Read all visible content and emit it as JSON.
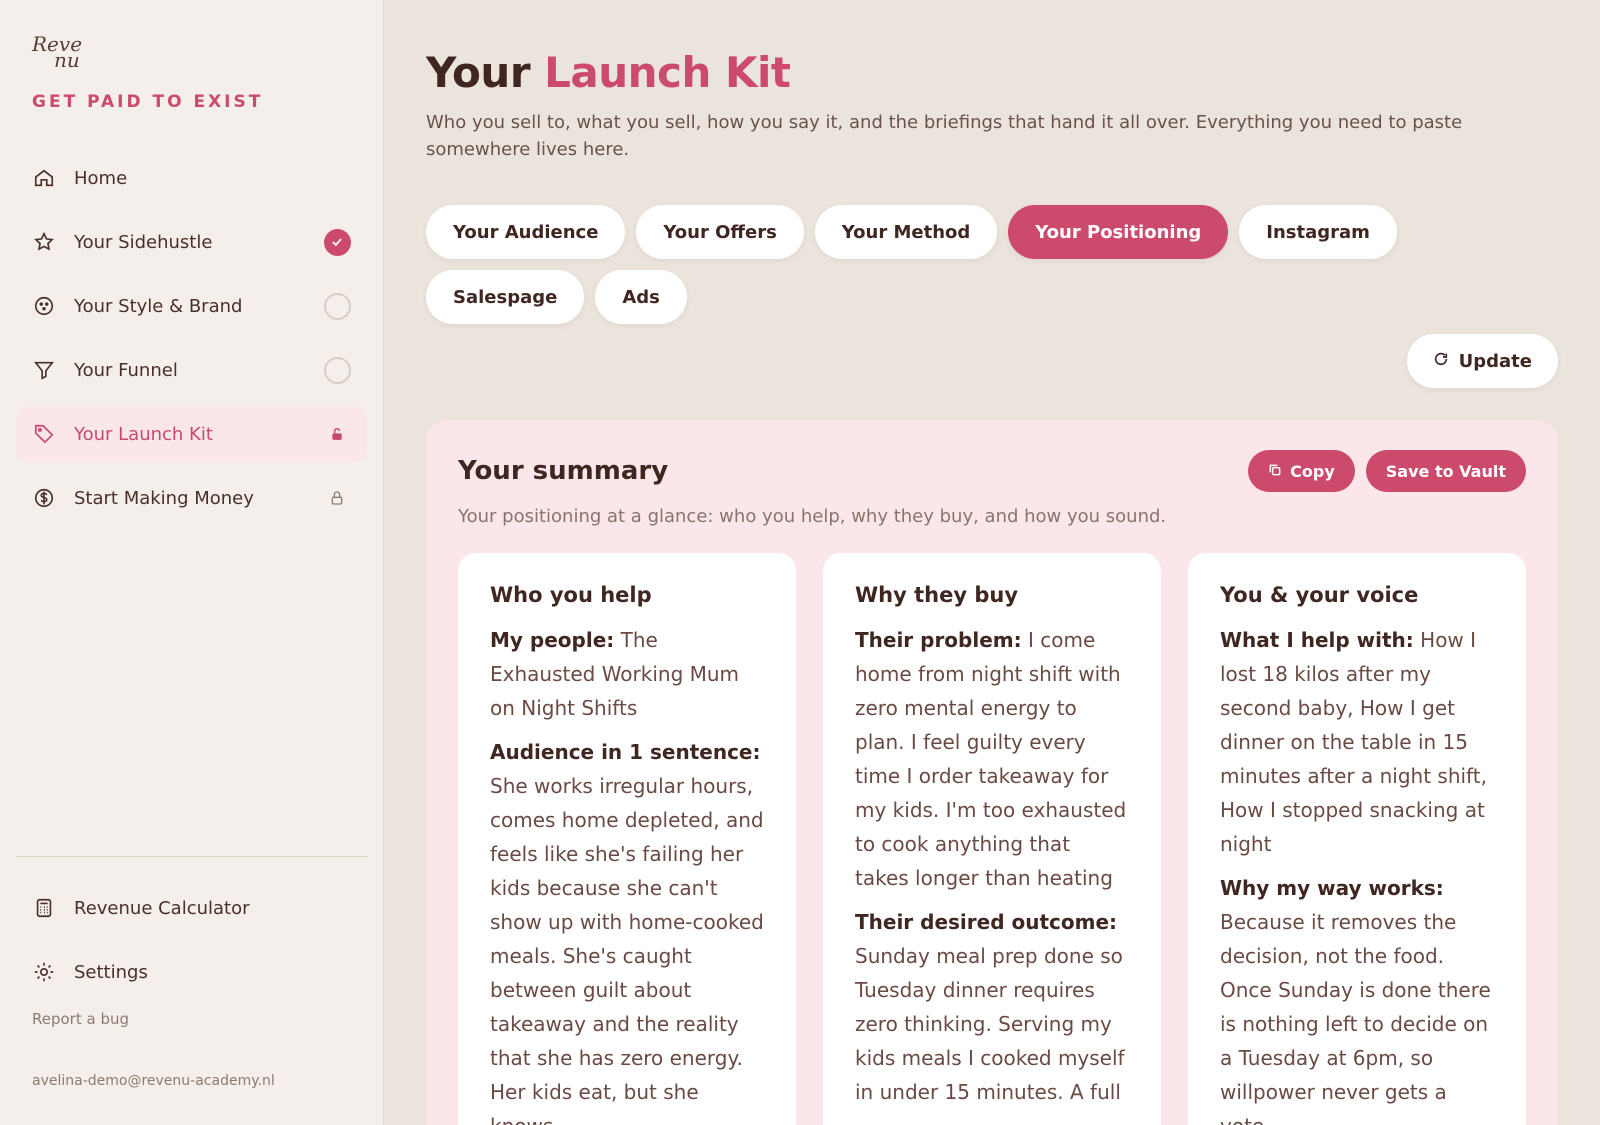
{
  "brand": {
    "logo_line1": "Reve",
    "logo_line2": "nu",
    "tagline": "GET PAID TO EXIST",
    "accent": "#cc4a6b"
  },
  "sidebar": {
    "items": [
      {
        "label": "Home",
        "icon": "home-icon",
        "status": "none"
      },
      {
        "label": "Your Sidehustle",
        "icon": "star-icon",
        "status": "complete"
      },
      {
        "label": "Your Style & Brand",
        "icon": "palette-icon",
        "status": "incomplete"
      },
      {
        "label": "Your Funnel",
        "icon": "funnel-icon",
        "status": "incomplete"
      },
      {
        "label": "Your Launch Kit",
        "icon": "tag-icon",
        "status": "unlocked",
        "active": true
      },
      {
        "label": "Start Making Money",
        "icon": "dollar-icon",
        "status": "locked"
      }
    ],
    "bottom": [
      {
        "label": "Revenue Calculator",
        "icon": "calculator-icon"
      },
      {
        "label": "Settings",
        "icon": "gear-icon"
      }
    ],
    "report_bug": "Report a bug",
    "email": "avelina-demo@revenu-academy.nl"
  },
  "header": {
    "title_plain": "Your",
    "title_accent": "Launch Kit",
    "subtitle": "Who you sell to, what you sell, how you say it, and the briefings that hand it all over. Everything you need to paste somewhere lives here."
  },
  "tabs": [
    {
      "label": "Your Audience"
    },
    {
      "label": "Your Offers"
    },
    {
      "label": "Your Method"
    },
    {
      "label": "Your Positioning",
      "active": true
    },
    {
      "label": "Instagram"
    },
    {
      "label": "Salespage"
    },
    {
      "label": "Ads"
    }
  ],
  "update_label": "Update",
  "summary": {
    "title": "Your summary",
    "subtitle": "Your positioning at a glance: who you help, why they buy, and how you sound.",
    "copy_label": "Copy",
    "save_label": "Save to Vault",
    "cards": [
      {
        "title": "Who you help",
        "fields": [
          {
            "key": "My people:",
            "value": "The Exhausted Working Mum on Night Shifts"
          },
          {
            "key": "Audience in 1 sentence:",
            "value": "She works irregular hours, comes home depleted, and feels like she's failing her kids because she can't show up with home-cooked meals. She's caught between guilt about takeaway and the reality that she has zero energy. Her kids eat, but she knows"
          }
        ]
      },
      {
        "title": "Why they buy",
        "fields": [
          {
            "key": "Their problem:",
            "value": "I come home from night shift with zero mental energy to plan. I feel guilty every time I order takeaway for my kids. I'm too exhausted to cook anything that takes longer than heating"
          },
          {
            "key": "Their desired outcome:",
            "value": "Sunday meal prep done so Tuesday dinner requires zero thinking. Serving my kids meals I cooked myself in under 15 minutes. A full"
          }
        ]
      },
      {
        "title": "You & your voice",
        "fields": [
          {
            "key": "What I help with:",
            "value": "How I lost 18 kilos after my second baby, How I get dinner on the table in 15 minutes after a night shift, How I stopped snacking at night"
          },
          {
            "key": "Why my way works:",
            "value": "Because it removes the decision, not the food. Once Sunday is done there is nothing left to decide on a Tuesday at 6pm, so willpower never gets a vote."
          }
        ]
      }
    ]
  }
}
